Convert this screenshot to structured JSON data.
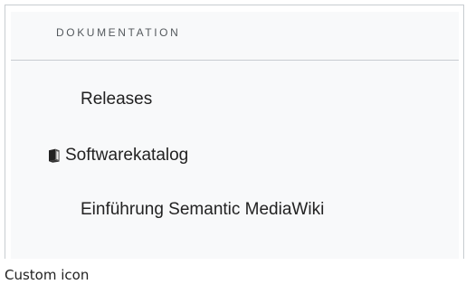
{
  "sidebar": {
    "section_title": "DOKUMENTATION",
    "items": [
      {
        "label": "Releases",
        "icon": null
      },
      {
        "label": "Softwarekatalog",
        "icon": "book-icon"
      },
      {
        "label": "Einführung Semantic MediaWiki",
        "icon": null
      }
    ]
  },
  "caption": "Custom icon",
  "colors": {
    "panel_background": "#f8f9fa",
    "section_title": "#54595d",
    "item_text": "#222222",
    "divider": "#c8ccd1"
  }
}
